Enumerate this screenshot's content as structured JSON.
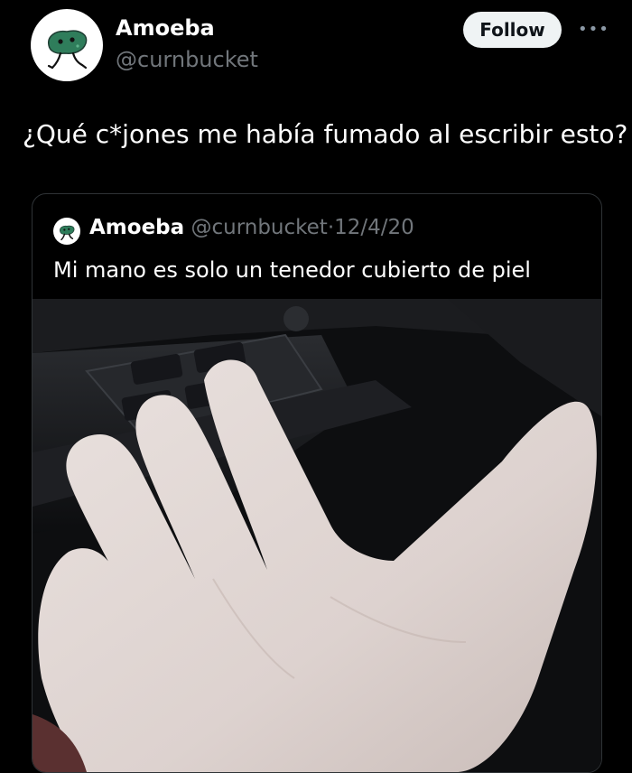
{
  "author": {
    "name": "Amoeba",
    "handle": "@curnbucket"
  },
  "follow_label": "Follow",
  "more_icon": "more-horizontal-icon",
  "tweet_text": "¿Qué c*jones me había fumado al escribir esto?",
  "quote": {
    "name": "Amoeba",
    "handle": "@curnbucket",
    "separator": "·",
    "date": "12/4/20",
    "text": "Mi mano es solo un tenedor cubierto de piel"
  },
  "colors": {
    "background": "#000000",
    "follow_button": "#eff3f4",
    "avatar_blob": "#2f7d5b"
  }
}
